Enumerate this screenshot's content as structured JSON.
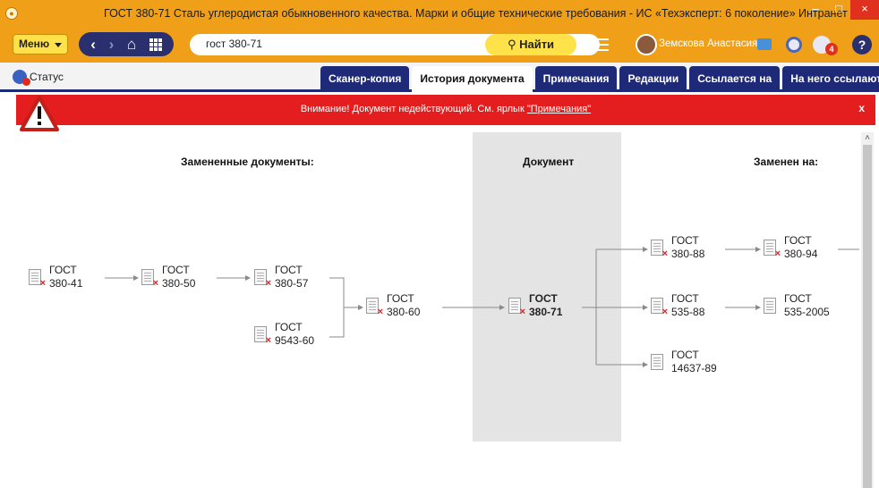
{
  "window": {
    "title": "ГОСТ 380-71 Сталь углеродистая обыкновенного качества. Марки и общие технические требования - ИС «Техэксперт: 6 поколение» Интранет"
  },
  "toolbar": {
    "menu_label": "Меню",
    "search_value": "гост 380-71",
    "find_label": "Найти",
    "user_name": "Земскова Анастасия",
    "notification_count": "4",
    "help_label": "?"
  },
  "status_label": "Статус",
  "tabs": [
    {
      "label": "Сканер-копия",
      "active": false
    },
    {
      "label": "История документа",
      "active": true
    },
    {
      "label": "Примечания",
      "active": false
    },
    {
      "label": "Редакции",
      "active": false
    },
    {
      "label": "Ссылается на",
      "active": false
    },
    {
      "label": "На него ссылаются",
      "active": false
    }
  ],
  "banner": {
    "text": "Внимание! Документ недействующий. См. ярлык ",
    "link": "\"Примечания\"",
    "close": "x"
  },
  "history": {
    "replaced_header": "Замененные документы:",
    "document_header": "Документ",
    "replaced_by_header": "Заменен на:",
    "docs": {
      "g380_41": {
        "line1": "ГОСТ",
        "line2": "380-41"
      },
      "g380_50": {
        "line1": "ГОСТ",
        "line2": "380-50"
      },
      "g380_57": {
        "line1": "ГОСТ",
        "line2": "380-57"
      },
      "g9543_60": {
        "line1": "ГОСТ",
        "line2": "9543-60"
      },
      "g380_60": {
        "line1": "ГОСТ",
        "line2": "380-60"
      },
      "g380_71": {
        "line1": "ГОСТ",
        "line2": "380-71"
      },
      "g380_88": {
        "line1": "ГОСТ",
        "line2": "380-88"
      },
      "g535_88": {
        "line1": "ГОСТ",
        "line2": "535-88"
      },
      "g14637_89": {
        "line1": "ГОСТ",
        "line2": "14637-89"
      },
      "g380_94": {
        "line1": "ГОСТ",
        "line2": "380-94"
      },
      "g535_2005": {
        "line1": "ГОСТ",
        "line2": "535-2005"
      }
    }
  },
  "colors": {
    "chrome_orange": "#f0a018",
    "tab_navy": "#1e2a78",
    "banner_red": "#e41e1e",
    "column_gray": "#e4e4e4"
  }
}
